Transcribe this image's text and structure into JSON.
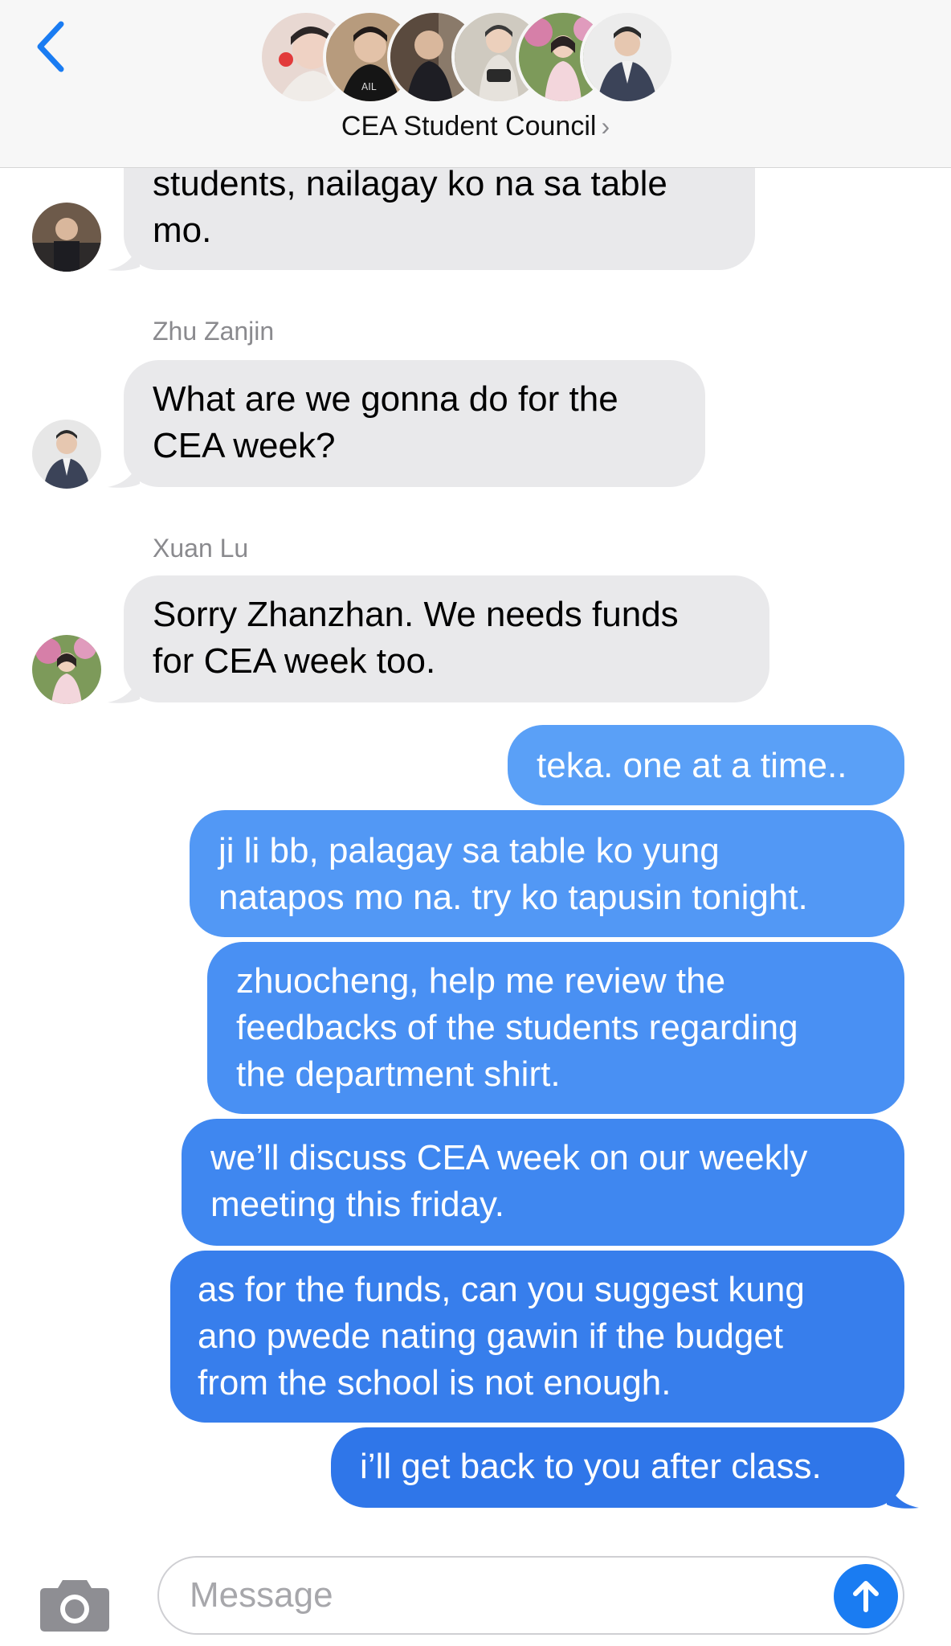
{
  "header": {
    "group_name": "CEA Student Council",
    "chevron": "›"
  },
  "messages": {
    "m0": "students, nailagay ko na sa table mo.",
    "m0_line1": "students, nailagay ko na sa table",
    "m0_line2": "mo.",
    "m1_sender": "Zhu Zanjin",
    "m1_line1": "What are we gonna do for the",
    "m1_line2": "CEA week?",
    "m2_sender": "Xuan Lu",
    "m2_line1": "Sorry Zhanzhan. We needs funds",
    "m2_line2": "for CEA week too.",
    "o1": "teka. one at a time..",
    "o2_line1": "ji li bb, palagay sa table ko yung",
    "o2_line2": "natapos mo na. try ko tapusin tonight.",
    "o3_line1": "zhuocheng, help me review the",
    "o3_line2": "feedbacks of the students regarding",
    "o3_line3": "the department shirt.",
    "o4_line1": "we’ll discuss CEA week on our weekly",
    "o4_line2": "meeting this friday.",
    "o5_line1": "as for the funds, can you suggest kung",
    "o5_line2": "ano pwede nating gawin if the budget",
    "o5_line3": "from the school is not enough.",
    "o6": "i’ll get back to you after class."
  },
  "composer": {
    "placeholder": "Message",
    "value": ""
  },
  "colors": {
    "accent": "#1a7cf2",
    "incoming_bubble": "#e9e9eb",
    "outgoing_top": "#5aa0f7",
    "outgoing_bottom": "#2f6fe8"
  },
  "icons": {
    "back": "chevron-left-icon",
    "camera": "camera-icon",
    "send": "arrow-up-icon"
  }
}
